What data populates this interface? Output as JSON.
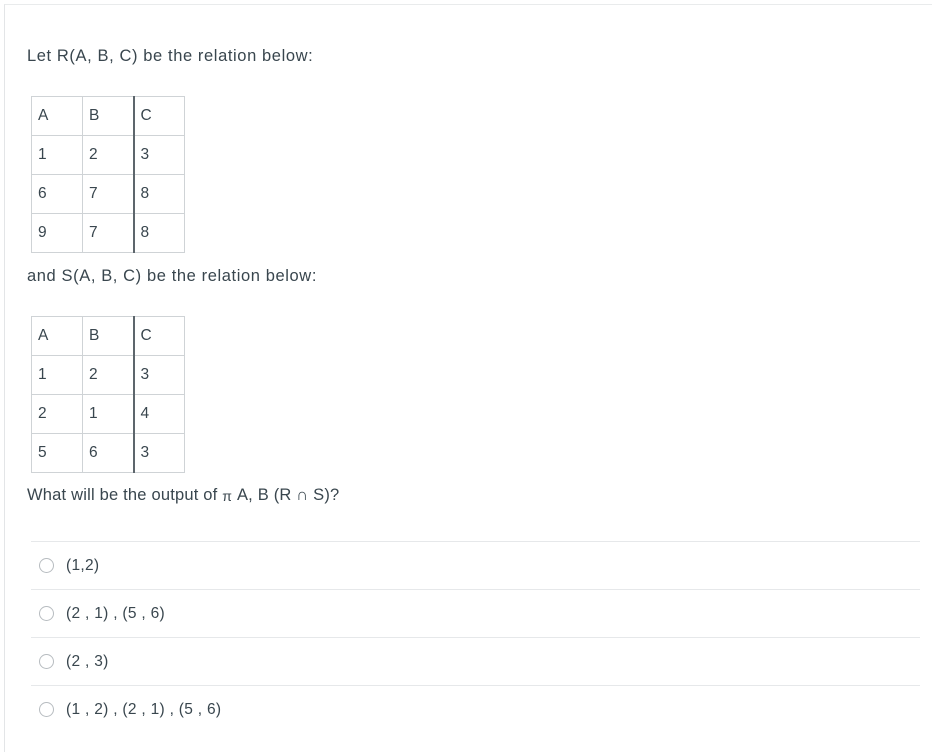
{
  "question_block": {
    "prompt_r": "Let  R(A, B, C)  be  the  relation  below:",
    "prompt_s": "and S(A, B, C)  be  the  relation  below:",
    "question_prefix": "What will be the output of",
    "pi_symbol": "π",
    "question_suffix": "A, B (R ∩ S)?"
  },
  "relation_r": {
    "name": "R",
    "headers": [
      "A",
      "B",
      "C"
    ],
    "rows": [
      [
        "1",
        "2",
        "3"
      ],
      [
        "6",
        "7",
        "8"
      ],
      [
        "9",
        "7",
        "8"
      ]
    ]
  },
  "relation_s": {
    "name": "S",
    "headers": [
      "A",
      "B",
      "C"
    ],
    "rows": [
      [
        "1",
        "2",
        "3"
      ],
      [
        "2",
        "1",
        "4"
      ],
      [
        "5",
        "6",
        "3"
      ]
    ]
  },
  "answer_options": [
    {
      "label": "(1,2)"
    },
    {
      "label": "(2 , 1) , (5 , 6)"
    },
    {
      "label": "(2 , 3)"
    },
    {
      "label": "(1 , 2) , (2 , 1) , (5 , 6)"
    }
  ],
  "colors": {
    "text": "#39464e",
    "table_border": "#cfd3d6",
    "table_strong_border": "#5d666c",
    "separator": "#e6e8ea",
    "radio_border": "#b7bcc0",
    "background": "#ffffff"
  }
}
